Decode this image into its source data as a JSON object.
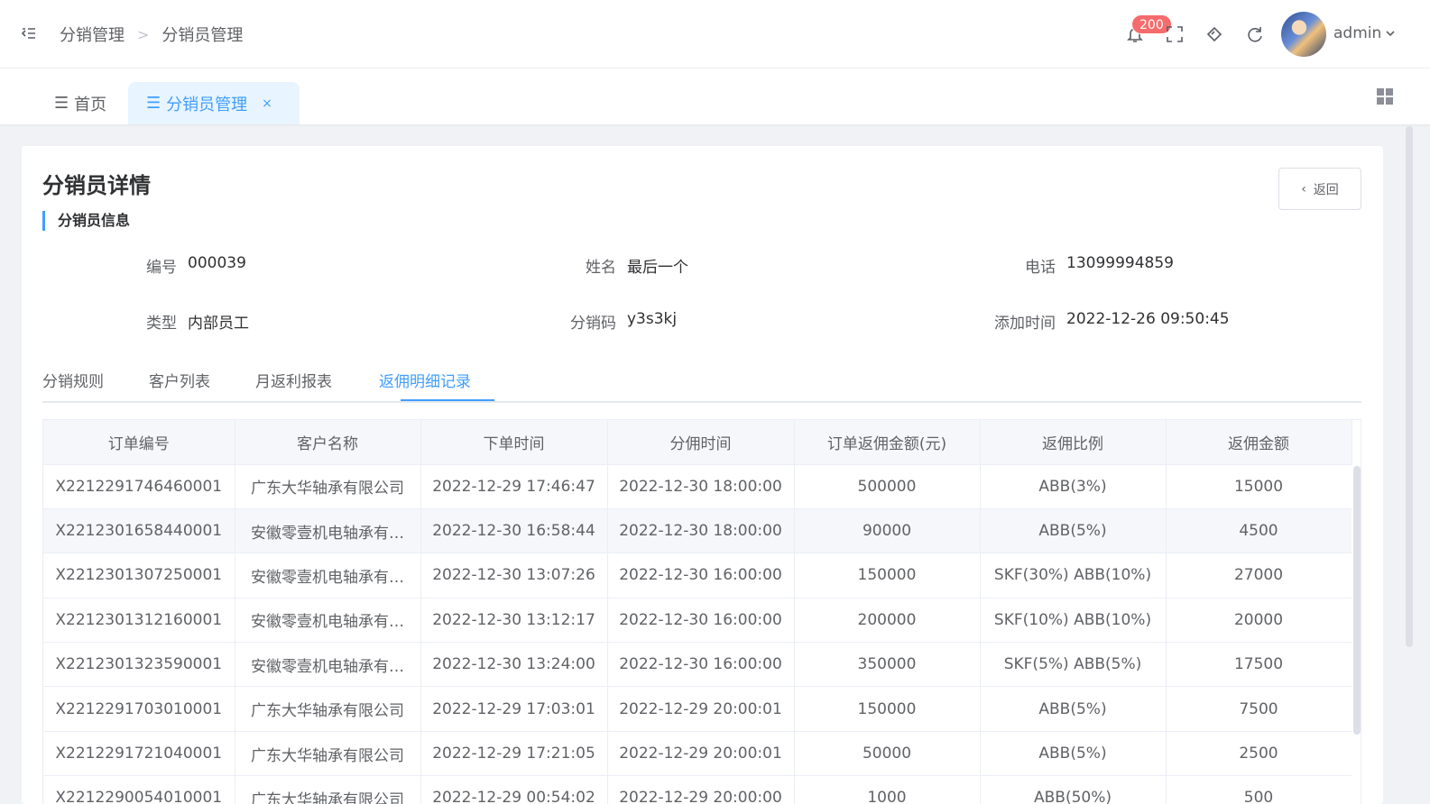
{
  "breadcrumb": {
    "root": "分销管理",
    "separator": ">",
    "current": "分销员管理"
  },
  "notifications": {
    "count": "200"
  },
  "user": {
    "name": "admin"
  },
  "tags": {
    "home": "首页",
    "active": "分销员管理"
  },
  "page": {
    "title": "分销员详情",
    "back_label": "返回",
    "section": "分销员信息"
  },
  "info": {
    "id_label": "编号",
    "id": "000039",
    "name_label": "姓名",
    "name": "最后一个",
    "phone_label": "电话",
    "phone": "13099994859",
    "type_label": "类型",
    "type": "内部员工",
    "code_label": "分销码",
    "code": "y3s3kj",
    "added_label": "添加时间",
    "added": "2022-12-26 09:50:45"
  },
  "tabs": [
    "分销规则",
    "客户列表",
    "月返利报表",
    "返佣明细记录"
  ],
  "table": {
    "columns": [
      "订单编号",
      "客户名称",
      "下单时间",
      "分佣时间",
      "订单返佣金额(元)",
      "返佣比例",
      "返佣金额"
    ],
    "rows": [
      [
        "X2212291746460001",
        "广东大华轴承有限公司",
        "2022-12-29 17:46:47",
        "2022-12-30 18:00:00",
        "500000",
        "ABB(3%)",
        "15000"
      ],
      [
        "X2212301658440001",
        "安徽零壹机电轴承有…",
        "2022-12-30 16:58:44",
        "2022-12-30 18:00:00",
        "90000",
        "ABB(5%)",
        "4500"
      ],
      [
        "X2212301307250001",
        "安徽零壹机电轴承有…",
        "2022-12-30 13:07:26",
        "2022-12-30 16:00:00",
        "150000",
        "SKF(30%) ABB(10%)",
        "27000"
      ],
      [
        "X2212301312160001",
        "安徽零壹机电轴承有…",
        "2022-12-30 13:12:17",
        "2022-12-30 16:00:00",
        "200000",
        "SKF(10%) ABB(10%)",
        "20000"
      ],
      [
        "X2212301323590001",
        "安徽零壹机电轴承有…",
        "2022-12-30 13:24:00",
        "2022-12-30 16:00:00",
        "350000",
        "SKF(5%) ABB(5%)",
        "17500"
      ],
      [
        "X2212291703010001",
        "广东大华轴承有限公司",
        "2022-12-29 17:03:01",
        "2022-12-29 20:00:01",
        "150000",
        "ABB(5%)",
        "7500"
      ],
      [
        "X2212291721040001",
        "广东大华轴承有限公司",
        "2022-12-29 17:21:05",
        "2022-12-29 20:00:01",
        "50000",
        "ABB(5%)",
        "2500"
      ],
      [
        "X2212290054010001",
        "广东大华轴承有限公司",
        "2022-12-29 00:54:02",
        "2022-12-29 20:00:00",
        "1000",
        "ABB(50%)",
        "500"
      ]
    ]
  }
}
